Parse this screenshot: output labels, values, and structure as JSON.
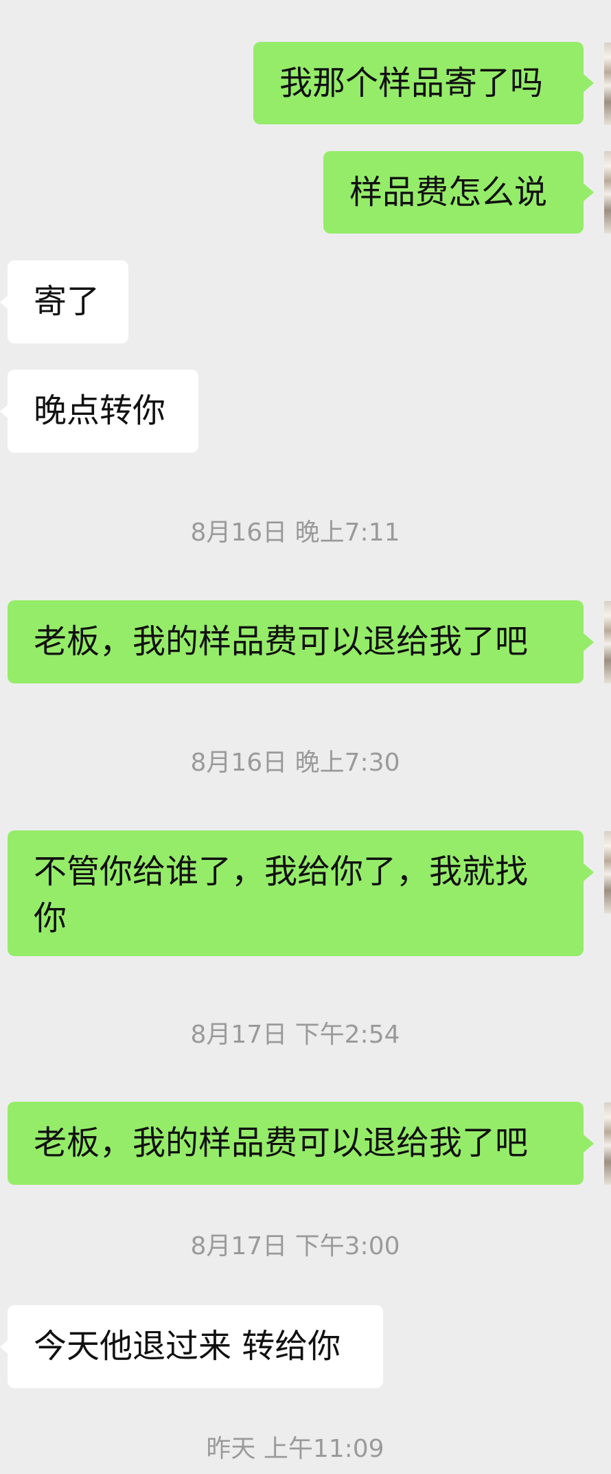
{
  "messages": [
    {
      "sender": "me",
      "text": "我那个样品寄了吗"
    },
    {
      "sender": "me",
      "text": "样品费怎么说"
    },
    {
      "sender": "other",
      "text": "寄了"
    },
    {
      "sender": "other",
      "text": "晚点转你"
    },
    {
      "type": "timestamp",
      "text": "8月16日 晚上7:11"
    },
    {
      "sender": "me",
      "text": "老板，我的样品费可以退给我了吧"
    },
    {
      "type": "timestamp",
      "text": "8月16日 晚上7:30"
    },
    {
      "sender": "me",
      "text": "不管你给谁了，我给你了，我就找你"
    },
    {
      "type": "timestamp",
      "text": "8月17日 下午2:54"
    },
    {
      "sender": "me",
      "text": "老板，我的样品费可以退给我了吧"
    },
    {
      "type": "timestamp",
      "text": "8月17日 下午3:00"
    },
    {
      "sender": "other",
      "text": "今天他退过来 转给你"
    },
    {
      "type": "timestamp",
      "text": "昨天 上午11:09"
    }
  ],
  "colors": {
    "background": "#ededed",
    "sent_bubble": "#95ec69",
    "received_bubble": "#ffffff",
    "timestamp_text": "#9a9a9a"
  }
}
